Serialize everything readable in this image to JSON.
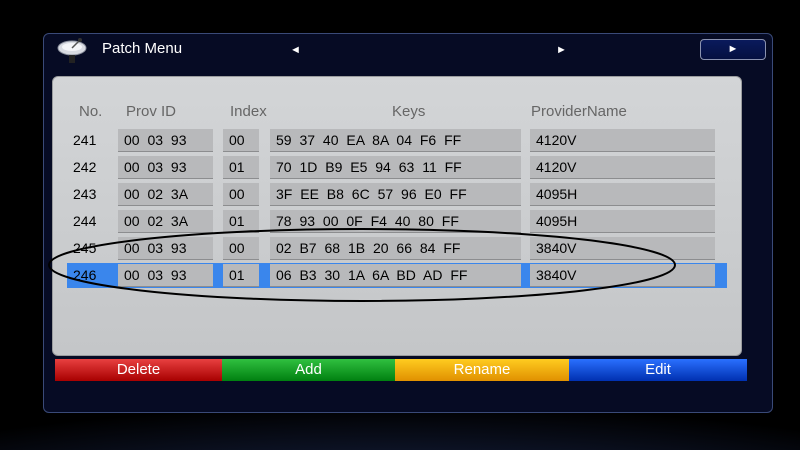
{
  "window": {
    "title": "Patch Menu",
    "prev_arrow": "◄",
    "next_arrow": "►",
    "next_button": "►"
  },
  "table": {
    "headers": {
      "no": "No.",
      "prov_id": "Prov ID",
      "index": "Index",
      "keys": "Keys",
      "provider_name": "ProviderName"
    },
    "rows": [
      {
        "no": "241",
        "prov_id": "00 03 93",
        "index": "00",
        "keys": "59 37 40 EA 8A 04 F6 FF",
        "provider_name": "4120V"
      },
      {
        "no": "242",
        "prov_id": "00 03 93",
        "index": "01",
        "keys": "70 1D B9 E5 94 63 11 FF",
        "provider_name": "4120V"
      },
      {
        "no": "243",
        "prov_id": "00 02 3A",
        "index": "00",
        "keys": "3F EE B8 6C 57 96 E0 FF",
        "provider_name": "4095H"
      },
      {
        "no": "244",
        "prov_id": "00 02 3A",
        "index": "01",
        "keys": "78 93 00 0F F4 40 80 FF",
        "provider_name": "4095H"
      },
      {
        "no": "245",
        "prov_id": "00 03 93",
        "index": "00",
        "keys": "02 B7 68 1B 20 66 84 FF",
        "provider_name": "3840V"
      },
      {
        "no": "246",
        "prov_id": "00 03 93",
        "index": "01",
        "keys": "06 B3 30 1A 6A BD AD FF",
        "provider_name": "3840V"
      }
    ],
    "selected_row": "246"
  },
  "buttons": {
    "delete": "Delete",
    "add": "Add",
    "rename": "Rename",
    "edit": "Edit"
  },
  "colors": {
    "red": "#d01818",
    "green": "#10a020",
    "yellow": "#f5b000",
    "blue": "#1050e0",
    "selection": "#3a86ec"
  },
  "icons": {
    "title": "satellite-dish-icon"
  }
}
